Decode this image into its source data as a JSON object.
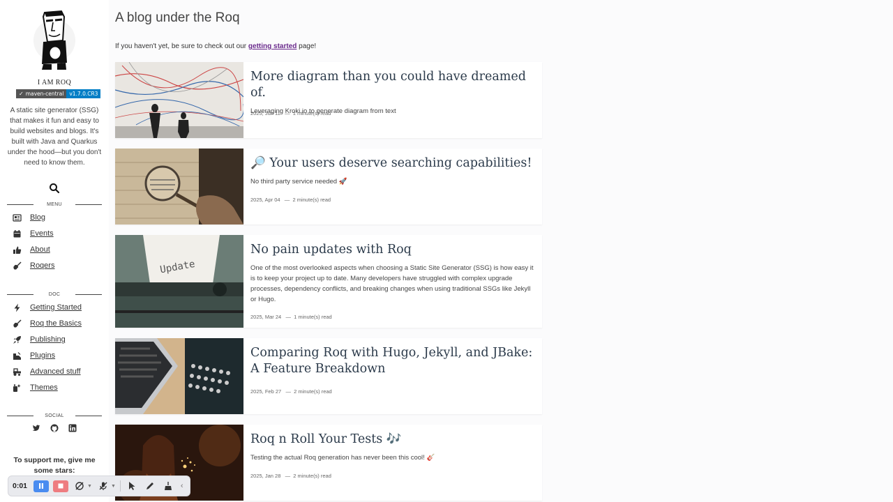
{
  "sidebar": {
    "site_title": "I AM ROQ",
    "badge": {
      "left": "maven-central",
      "right": "v1.7.0.CR3"
    },
    "description": "A static site generator (SSG) that makes it fun and easy to build websites and blogs. It's built with Java and Quarkus under the hood—but you don't need to know them.",
    "menu_header": "MENU",
    "menu": [
      {
        "label": "Blog",
        "icon": "newspaper-icon"
      },
      {
        "label": "Events",
        "icon": "calendar-icon"
      },
      {
        "label": "About",
        "icon": "thumbs-up-icon"
      },
      {
        "label": "Roqers",
        "icon": "guitar-icon"
      }
    ],
    "doc_header": "DOC",
    "doc": [
      {
        "label": "Getting Started",
        "icon": "bolt-icon"
      },
      {
        "label": "Roq the Basics",
        "icon": "guitar-icon"
      },
      {
        "label": "Publishing",
        "icon": "rocket-icon"
      },
      {
        "label": "Plugins",
        "icon": "plug-icon"
      },
      {
        "label": "Advanced stuff",
        "icon": "tractor-icon"
      },
      {
        "label": "Themes",
        "icon": "palette-icon"
      }
    ],
    "social_header": "SOCIAL",
    "social": [
      "twitter-icon",
      "github-icon",
      "linkedin-icon"
    ],
    "support_text": "To support me, give me some stars:"
  },
  "recorder": {
    "time": "0:01"
  },
  "main": {
    "title": "A blog under the Roq",
    "intro_before": "If you haven't yet, be sure to check out our ",
    "intro_link": "getting started",
    "intro_after": " page!",
    "posts": [
      {
        "title": "More diagram than you could have dreamed of.",
        "summary": "Leveraging Kroki.io to generate diagram from text",
        "date": "2025, Jun 11",
        "read": "1 minute(s) read"
      },
      {
        "title": "🔎 Your users deserve searching capabilities!",
        "summary": "No third party service needed 🚀",
        "date": "2025, Apr 04",
        "read": "2 minute(s) read"
      },
      {
        "title": "No pain updates with Roq",
        "summary": "One of the most overlooked aspects when choosing a Static Site Generator (SSG) is how easy it is to keep your project up to date. Many developers have struggled with complex upgrade processes, dependency conflicts, and breaking changes when using traditional SSGs like Jekyll or Hugo.",
        "date": "2025, Mar 24",
        "read": "1 minute(s) read"
      },
      {
        "title": "Comparing Roq with Hugo, Jekyll, and JBake: A Feature Breakdown",
        "summary": "",
        "date": "2025, Feb 27",
        "read": "2 minute(s) read"
      },
      {
        "title": "Roq n Roll Your Tests 🎶",
        "summary": "Testing the actual Roq generation has never been this cool! 🎸",
        "date": "2025, Jan 28",
        "read": "2 minute(s) read"
      }
    ],
    "update_paper_text": "Update"
  }
}
